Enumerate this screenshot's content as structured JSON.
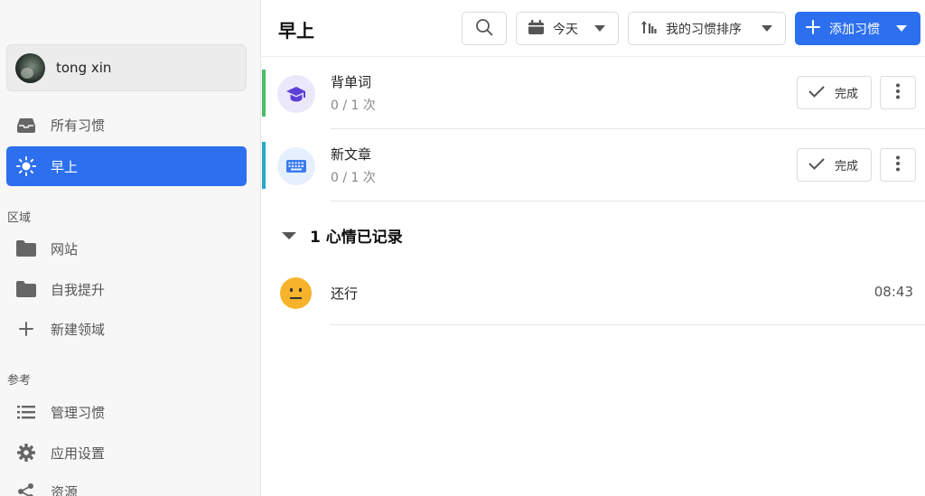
{
  "user": {
    "name": "tong xin"
  },
  "sidebar": {
    "nav": [
      {
        "label": "所有习惯",
        "icon": "inbox-icon"
      },
      {
        "label": "早上",
        "icon": "sun-icon",
        "active": true
      }
    ],
    "areas_label": "区域",
    "areas": [
      {
        "label": "网站",
        "icon": "folder-icon"
      },
      {
        "label": "自我提升",
        "icon": "folder-icon"
      },
      {
        "label": "新建领域",
        "icon": "plus-icon"
      }
    ],
    "reference_label": "参考",
    "reference": [
      {
        "label": "管理习惯",
        "icon": "list-icon"
      },
      {
        "label": "应用设置",
        "icon": "gear-icon"
      },
      {
        "label": "资源",
        "icon": "share-icon"
      }
    ]
  },
  "header": {
    "title": "早上",
    "date_label": "今天",
    "sort_label": "我的习惯排序",
    "add_label": "添加习惯"
  },
  "habits": [
    {
      "name": "背单词",
      "progress": "0 / 1 次",
      "icon": "graduation-cap-icon",
      "stripe_color": "#4cbb6c",
      "icon_bg": "#ece8fb",
      "icon_color": "#5b3fd6",
      "done_label": "完成"
    },
    {
      "name": "新文章",
      "progress": "0 / 1 次",
      "icon": "keyboard-icon",
      "stripe_color": "#2aa7c9",
      "icon_bg": "#e6effd",
      "icon_color": "#3a7bef",
      "done_label": "完成"
    }
  ],
  "moods": {
    "header": "1 心情已记录",
    "items": [
      {
        "label": "还行",
        "time": "08:43",
        "icon": "neutral-face-icon"
      }
    ]
  },
  "colors": {
    "accent": "#2c6fef"
  }
}
